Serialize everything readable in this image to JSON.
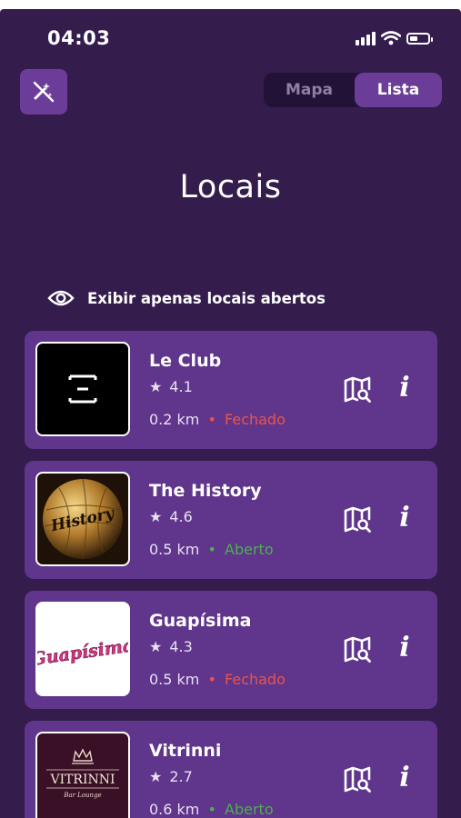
{
  "status_bar": {
    "time": "04:03"
  },
  "header": {
    "mode_icon": "magic-wand-off-icon",
    "segmented": {
      "options": [
        "Mapa",
        "Lista"
      ],
      "selected": "Lista"
    },
    "title": "Locais"
  },
  "filter": {
    "icon": "eye-icon",
    "label": "Exibir apenas locais abertos"
  },
  "colors": {
    "background": "#341c4c",
    "card": "#60358c",
    "accent": "#6b3d99",
    "closed": "#e8554e",
    "open": "#4caf50"
  },
  "places": [
    {
      "name": "Le Club",
      "rating": "4.1",
      "distance": "0.2 km",
      "separator": "•",
      "status": "Fechado",
      "status_color": "#e8554e",
      "logo": "le-club-logo"
    },
    {
      "name": "The History",
      "rating": "4.6",
      "distance": "0.5 km",
      "separator": "•",
      "status": "Aberto",
      "status_color": "#4caf50",
      "logo": "the-history-logo",
      "logo_text": "History"
    },
    {
      "name": "Guapísima",
      "rating": "4.3",
      "distance": "0.5 km",
      "separator": "•",
      "status": "Fechado",
      "status_color": "#e8554e",
      "logo": "guapisima-logo",
      "logo_text": "Guapísima"
    },
    {
      "name": "Vitrinni",
      "rating": "2.7",
      "distance": "0.6 km",
      "separator": "•",
      "status": "Aberto",
      "status_color": "#4caf50",
      "logo": "vitrinni-logo",
      "logo_text": "VITRINNI",
      "logo_subtext": "Bar Lounge"
    }
  ],
  "card_actions": {
    "map_icon": "map-search-icon",
    "info_icon": "info-icon",
    "info_glyph": "i"
  }
}
